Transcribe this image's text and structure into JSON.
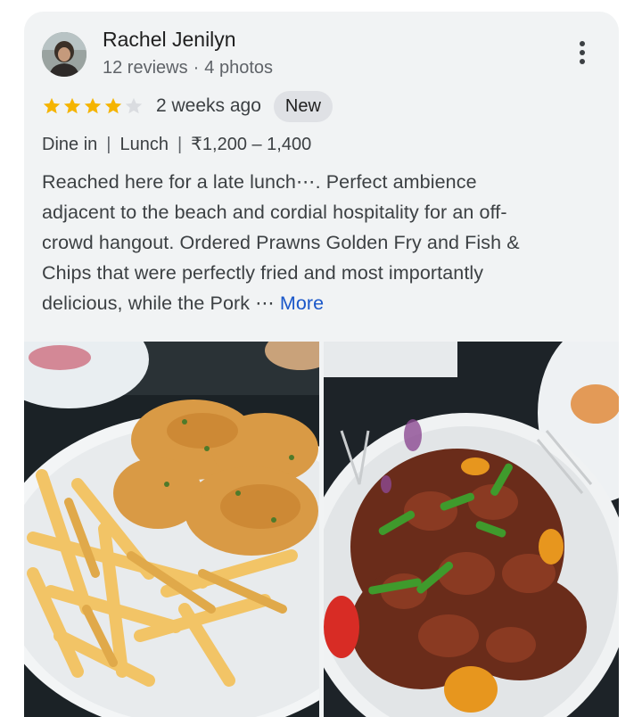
{
  "review": {
    "author_name": "Rachel Jenilyn",
    "author_reviews": "12 reviews",
    "author_photos": "4 photos",
    "rating": 4,
    "rating_max": 5,
    "time_ago": "2 weeks ago",
    "badge": "New",
    "tags": [
      "Dine in",
      "Lunch",
      "₹1,200 – 1,400"
    ],
    "text_lines": [
      "Reached here for a late lunch⋯. Perfect ambience",
      "adjacent to the beach and cordial hospitality for an off-",
      "crowd hangout. Ordered Prawns Golden Fry and Fish &",
      "Chips that were perfectly fried and most importantly",
      "delicious, while the Pork ⋯"
    ],
    "more_label": "More"
  },
  "photos": [
    {
      "icon": "fish-and-chips-photo"
    },
    {
      "icon": "chilli-pork-photo"
    }
  ],
  "colors": {
    "star_filled": "#f5b400",
    "star_empty": "#dadce0",
    "link": "#1a57c9",
    "card_bg": "#f1f3f4"
  }
}
